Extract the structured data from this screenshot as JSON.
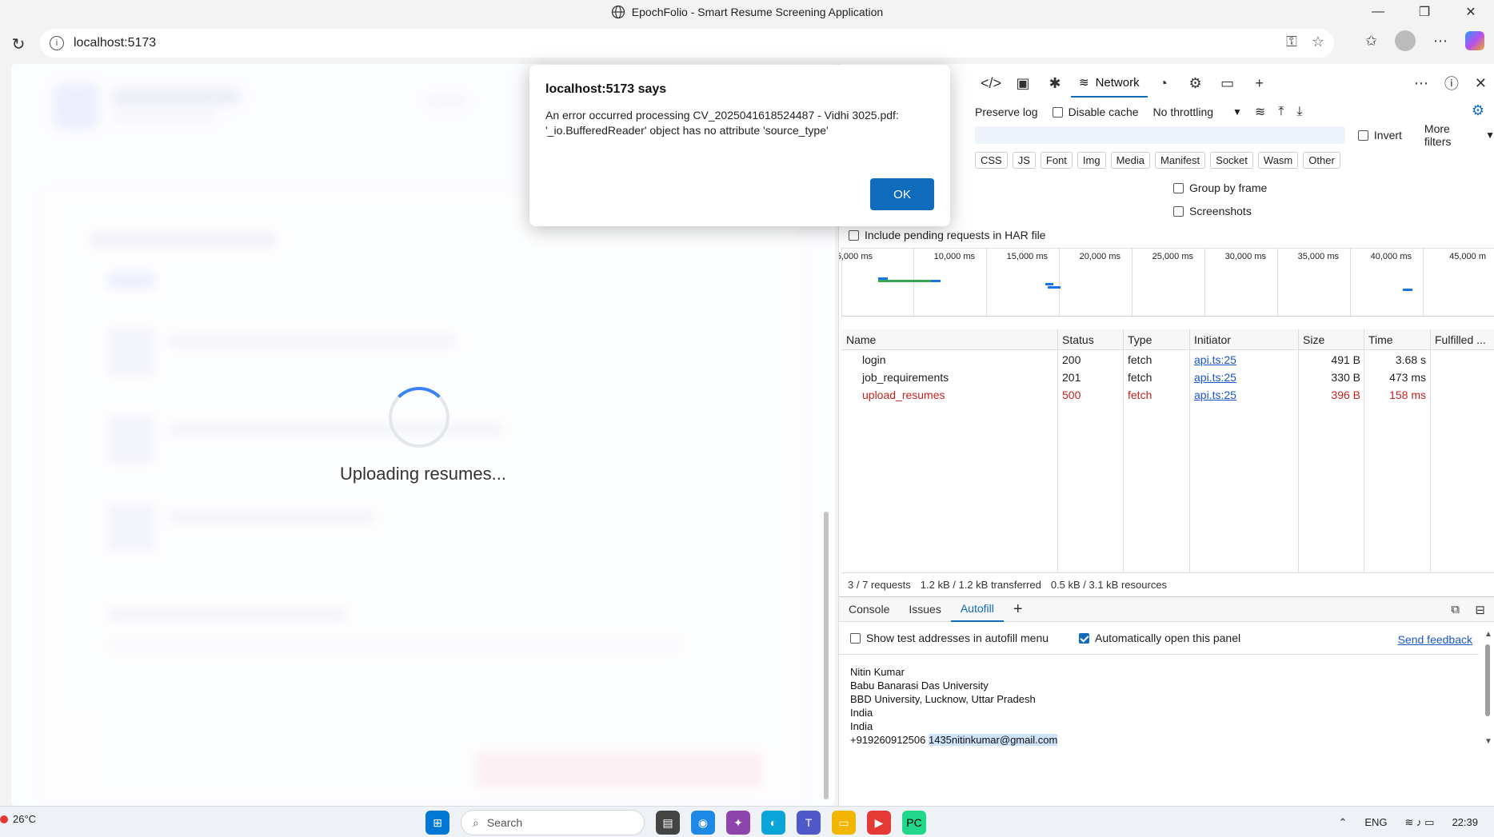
{
  "window": {
    "title": "EpochFolio - Smart Resume Screening Application",
    "controls": [
      "—",
      "❐",
      "✕"
    ]
  },
  "browser": {
    "url": "localhost:5173"
  },
  "page": {
    "status_text": "Uploading resumes..."
  },
  "dialog": {
    "title": "localhost:5173 says",
    "message_line1": "An error occurred processing CV_2025041618524487 - Vidhi 3025.pdf:",
    "message_line2": "'_io.BufferedReader' object has no attribute 'source_type'",
    "ok_label": "OK"
  },
  "devtools": {
    "active_tab": "Network",
    "preserve_log": "Preserve log",
    "disable_cache": "Disable cache",
    "throttling": "No throttling",
    "invert": "Invert",
    "more_filters": "More filters",
    "filter_chips": [
      "CSS",
      "JS",
      "Font",
      "Img",
      "Media",
      "Manifest",
      "Socket",
      "Wasm",
      "Other"
    ],
    "group_by_frame": "Group by frame",
    "screenshots": "Screenshots",
    "include_pending": "Include pending requests in HAR file",
    "timeline_labels": [
      "5,000 ms",
      "10,000 ms",
      "15,000 ms",
      "20,000 ms",
      "25,000 ms",
      "30,000 ms",
      "35,000 ms",
      "40,000 ms",
      "45,000 m"
    ],
    "columns": [
      "Name",
      "Status",
      "Type",
      "Initiator",
      "Size",
      "Time",
      "Fulfilled ..."
    ],
    "requests": [
      {
        "name": "login",
        "status": "200",
        "type": "fetch",
        "initiator": "api.ts:25",
        "size": "491 B",
        "time": "3.68 s",
        "error": false
      },
      {
        "name": "job_requirements",
        "status": "201",
        "type": "fetch",
        "initiator": "api.ts:25",
        "size": "330 B",
        "time": "473 ms",
        "error": false
      },
      {
        "name": "upload_resumes",
        "status": "500",
        "type": "fetch",
        "initiator": "api.ts:25",
        "size": "396 B",
        "time": "158 ms",
        "error": true
      }
    ],
    "summary": {
      "requests": "3 / 7 requests",
      "transferred": "1.2 kB / 1.2 kB transferred",
      "resources": "0.5 kB / 3.1 kB resources"
    },
    "drawer_tabs": [
      "Console",
      "Issues",
      "Autofill"
    ],
    "active_drawer_tab": "Autofill",
    "autofill": {
      "show_test_addresses": "Show test addresses in autofill menu",
      "auto_open": "Automatically open this panel",
      "send_feedback": "Send feedback",
      "address_lines": [
        "Nitin Kumar",
        "Babu Banarasi Das University",
        "BBD University, Lucknow, Uttar Pradesh",
        "India",
        "India"
      ],
      "phone": "+919260912506",
      "email": "1435nitinkumar@gmail.com"
    }
  },
  "taskbar": {
    "temperature": "26°C",
    "search_placeholder": "Search",
    "language": "ENG",
    "time": "22:39"
  },
  "colors": {
    "accent": "#0f6cbd",
    "error": "#c5221f",
    "spinner": "#3b82f6"
  }
}
